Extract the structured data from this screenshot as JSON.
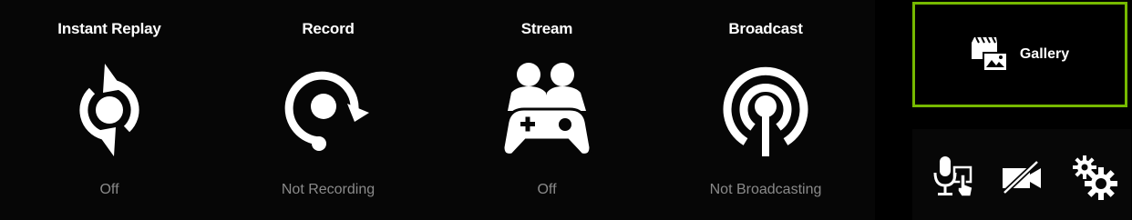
{
  "features": [
    {
      "title": "Instant Replay",
      "status": "Off",
      "icon": "instant-replay-icon"
    },
    {
      "title": "Record",
      "status": "Not Recording",
      "icon": "record-icon"
    },
    {
      "title": "Stream",
      "status": "Off",
      "icon": "stream-gamepad-icon"
    },
    {
      "title": "Broadcast",
      "status": "Not Broadcasting",
      "icon": "broadcast-icon"
    }
  ],
  "gallery": {
    "label": "Gallery",
    "icon": "gallery-icon"
  },
  "tools": [
    {
      "name": "microphone-push-to-talk",
      "icon": "mic-icon"
    },
    {
      "name": "webcam-off",
      "icon": "camera-off-icon"
    },
    {
      "name": "settings",
      "icon": "gears-icon"
    }
  ],
  "colors": {
    "accent": "#76b900",
    "status_text": "#8a8a8a",
    "background": "#000000"
  }
}
